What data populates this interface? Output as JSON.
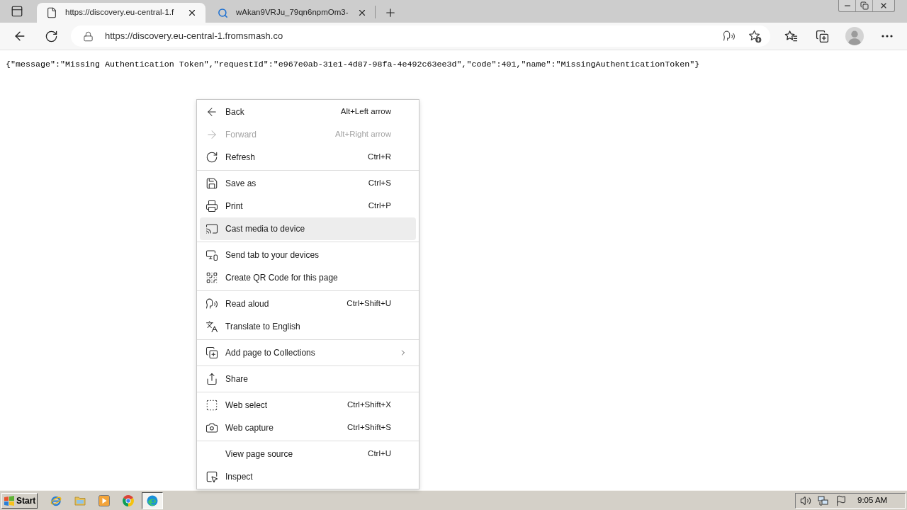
{
  "tabs": [
    {
      "title": "https://discovery.eu-central-1.f",
      "kind": "page",
      "selected": true
    },
    {
      "title": "wAkan9VRJu_79qn6npmOm3-",
      "kind": "search",
      "selected": false
    }
  ],
  "address_bar": {
    "url": "https://discovery.eu-central-1.fromsmash.co"
  },
  "page": {
    "text": "{\"message\":\"Missing Authentication Token\",\"requestId\":\"e967e0ab-31e1-4d87-98fa-4e492c63ee3d\",\"code\":401,\"name\":\"MissingAuthenticationToken\"}"
  },
  "context_menu": {
    "groups": [
      {
        "items": [
          {
            "label": "Back",
            "shortcut": "Alt+Left arrow",
            "kind": "back",
            "disabled": false,
            "selected": false,
            "submenu": false
          },
          {
            "label": "Forward",
            "shortcut": "Alt+Right arrow",
            "kind": "forward",
            "disabled": true,
            "selected": false,
            "submenu": false
          },
          {
            "label": "Refresh",
            "shortcut": "Ctrl+R",
            "kind": "refresh",
            "disabled": false,
            "selected": false,
            "submenu": false
          }
        ]
      },
      {
        "items": [
          {
            "label": "Save as",
            "shortcut": "Ctrl+S",
            "kind": "save",
            "disabled": false,
            "selected": false,
            "submenu": false
          },
          {
            "label": "Print",
            "shortcut": "Ctrl+P",
            "kind": "print",
            "disabled": false,
            "selected": false,
            "submenu": false
          },
          {
            "label": "Cast media to device",
            "kind": "cast",
            "disabled": false,
            "selected": true,
            "submenu": false
          }
        ]
      },
      {
        "items": [
          {
            "label": "Send tab to your devices",
            "kind": "devices",
            "disabled": false,
            "selected": false,
            "submenu": false
          },
          {
            "label": "Create QR Code for this page",
            "kind": "qr",
            "disabled": false,
            "selected": false,
            "submenu": false
          }
        ]
      },
      {
        "items": [
          {
            "label": "Read aloud",
            "shortcut": "Ctrl+Shift+U",
            "kind": "read_aloud",
            "disabled": false,
            "selected": false,
            "submenu": false
          },
          {
            "label": "Translate to English",
            "kind": "translate",
            "disabled": false,
            "selected": false,
            "submenu": false
          }
        ]
      },
      {
        "items": [
          {
            "label": "Add page to Collections",
            "kind": "collections",
            "disabled": false,
            "selected": false,
            "submenu": true
          }
        ]
      },
      {
        "items": [
          {
            "label": "Share",
            "kind": "share",
            "disabled": false,
            "selected": false,
            "submenu": false
          }
        ]
      },
      {
        "items": [
          {
            "label": "Web select",
            "shortcut": "Ctrl+Shift+X",
            "kind": "web_select",
            "disabled": false,
            "selected": false,
            "submenu": false
          },
          {
            "label": "Web capture",
            "shortcut": "Ctrl+Shift+S",
            "kind": "web_capture",
            "disabled": false,
            "selected": false,
            "submenu": false
          }
        ]
      },
      {
        "items": [
          {
            "label": "View page source",
            "shortcut": "Ctrl+U",
            "kind": "plain",
            "disabled": false,
            "selected": false,
            "submenu": false
          },
          {
            "label": "Inspect",
            "kind": "inspect",
            "disabled": false,
            "selected": false,
            "submenu": false
          }
        ]
      }
    ]
  },
  "taskbar": {
    "start": "Start",
    "apps": [
      {
        "kind": "ie",
        "selected": false
      },
      {
        "kind": "folder",
        "selected": false
      },
      {
        "kind": "media",
        "selected": false
      },
      {
        "kind": "chrome",
        "selected": false
      },
      {
        "kind": "edge",
        "selected": true
      }
    ],
    "clock": "9:05 AM"
  }
}
